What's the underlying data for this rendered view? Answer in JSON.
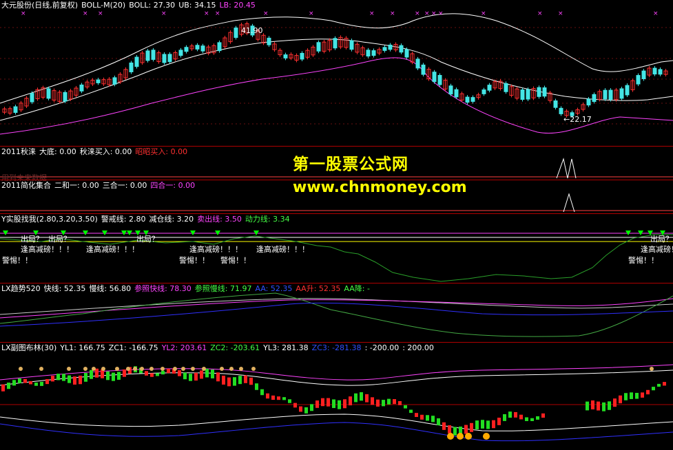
{
  "pane1": {
    "stock_name": "大元股份(日线,前复权)",
    "indicator": "BOLL-M(20)",
    "boll": "BOLL: 27.30",
    "ub": "UB: 34.15",
    "lb": "LB: 20.45",
    "high_label": "41.90",
    "low_label": "←22.17",
    "colors": {
      "boll": "#ffffff",
      "ub": "#ffffff",
      "lb": "#ff44ff",
      "up": "#ff3030",
      "down": "#44e5e5"
    }
  },
  "pane2": {
    "title": "2011秋涞",
    "v1": "大底: 0.00",
    "v2": "秋涞买入: 0.00",
    "v3": "昭昭买入: 0.00",
    "faint": "用到未来数据"
  },
  "pane3": {
    "title": "2011简化集合",
    "v1": "二和一: 0.00",
    "v2": "三合一: 0.00",
    "v3": "四合一: 0.00"
  },
  "pane4": {
    "title": "Y实股找我(2.80,3.20,3.50)",
    "v1": "警戒线: 2.80",
    "v2": "减仓线: 3.20",
    "v3": "卖出线: 3.50",
    "v4": "动力线: 3.34",
    "ann_chuju": "出局？",
    "ann_fenggao": "逢高减磅！！！",
    "ann_jingti": "警惕！！"
  },
  "pane5": {
    "title": "LX趋势520",
    "v1": "快线: 52.35",
    "v2": "慢线: 56.80",
    "v3": "参照快线: 78.30",
    "v4": "参照慢线: 71.97",
    "v5": "AA: 52.35",
    "v6": "AA升: 52.35",
    "v7": "AA降: -"
  },
  "pane6": {
    "title": "LX副图布林(30)",
    "v1": "YL1: 166.75",
    "v2": "ZC1: -166.75",
    "v3": "YL2: 203.61",
    "v4": "ZC2: -203.61",
    "v5": "YL3: 281.38",
    "v6": "ZC3: -281.38",
    "v7": ": -200.00",
    "v8": ": 200.00"
  },
  "watermark": {
    "line1": "第一股票公式网",
    "line2": "www.chnmoney.com"
  }
}
